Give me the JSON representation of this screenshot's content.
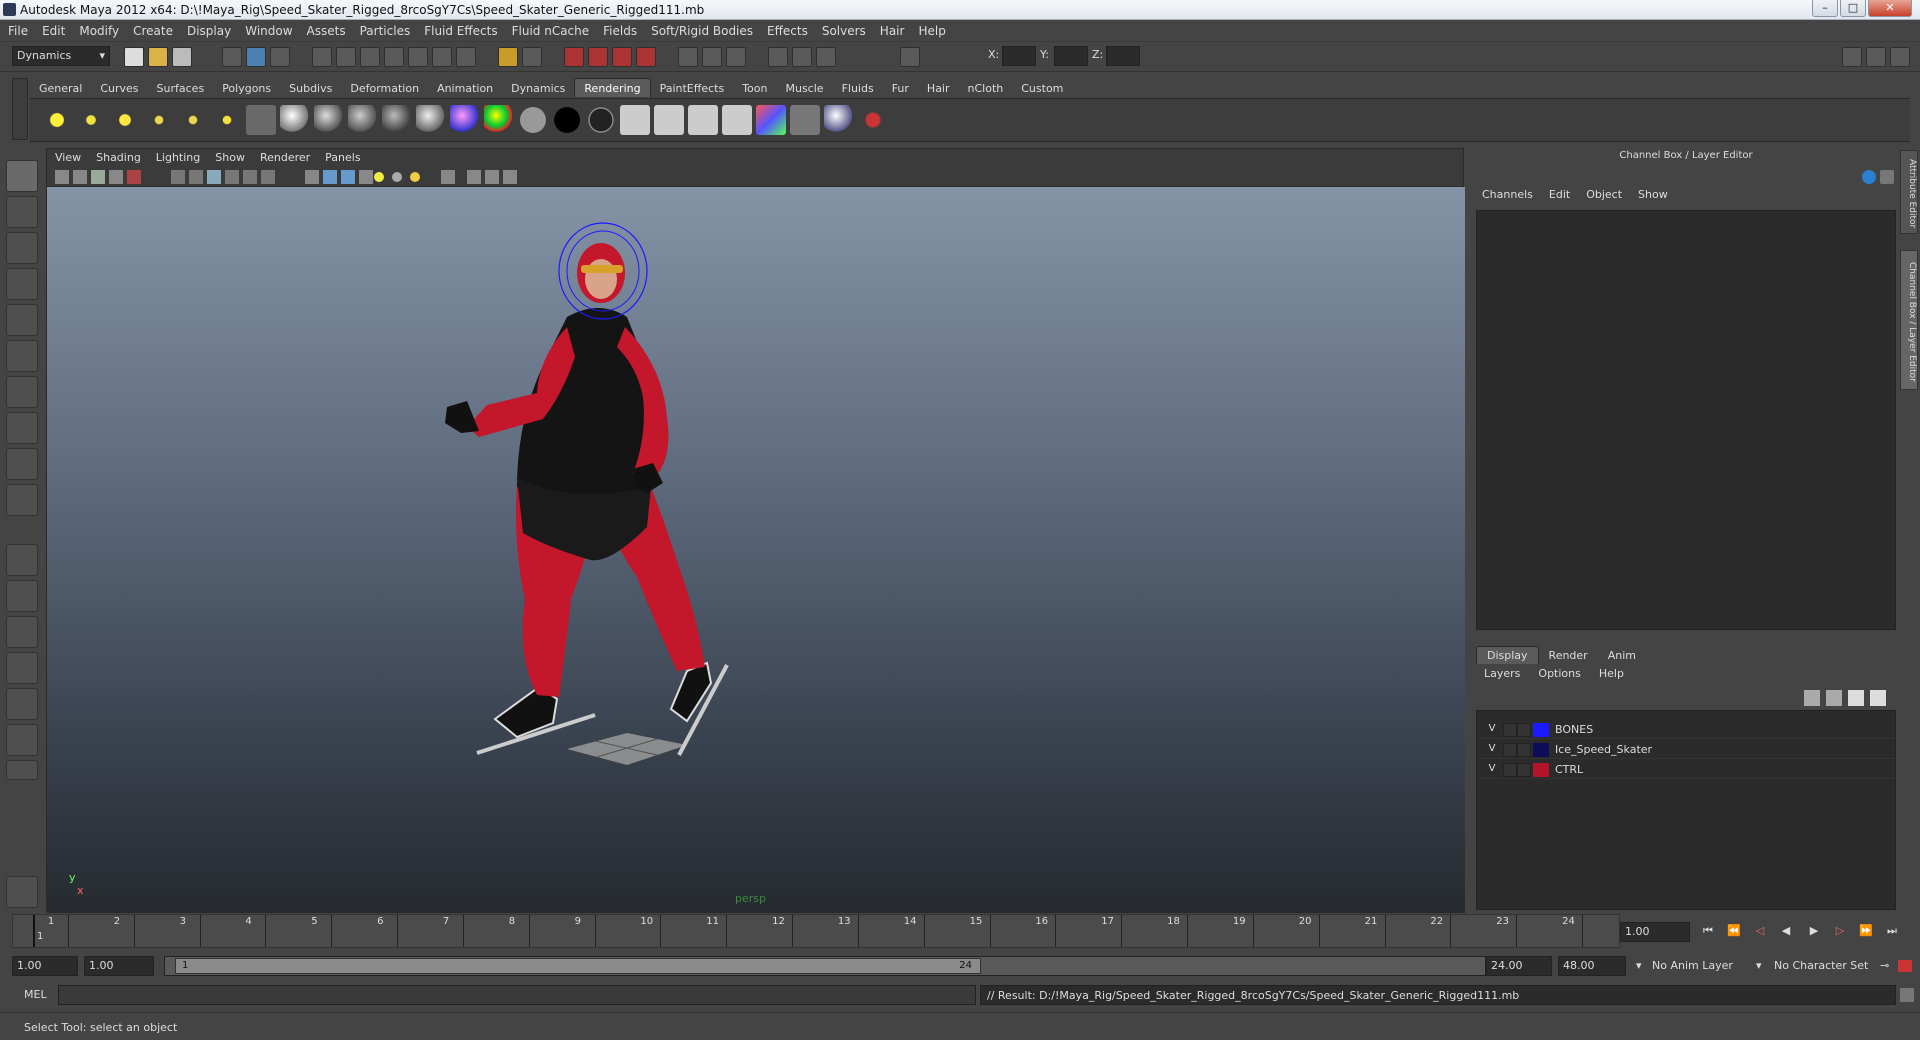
{
  "window": {
    "title": "Autodesk Maya 2012 x64: D:\\!Maya_Rig\\Speed_Skater_Rigged_8rcoSgY7Cs\\Speed_Skater_Generic_Rigged111.mb",
    "min": "–",
    "max": "□",
    "close": "✕"
  },
  "menubar": [
    "File",
    "Edit",
    "Modify",
    "Create",
    "Display",
    "Window",
    "Assets",
    "Particles",
    "Fluid Effects",
    "Fluid nCache",
    "Fields",
    "Soft/Rigid Bodies",
    "Effects",
    "Solvers",
    "Hair",
    "Help"
  ],
  "statusline": {
    "menuset": "Dynamics",
    "x_label": "X:",
    "y_label": "Y:",
    "z_label": "Z:"
  },
  "shelf": {
    "tabs": [
      "General",
      "Curves",
      "Surfaces",
      "Polygons",
      "Subdivs",
      "Deformation",
      "Animation",
      "Dynamics",
      "Rendering",
      "PaintEffects",
      "Toon",
      "Muscle",
      "Fluids",
      "Fur",
      "Hair",
      "nCloth",
      "Custom"
    ],
    "active_tab": "Rendering"
  },
  "viewport": {
    "menu": [
      "View",
      "Shading",
      "Lighting",
      "Show",
      "Renderer",
      "Panels"
    ],
    "camera_label": "persp",
    "axis_y": "y",
    "axis_x": "x"
  },
  "channel_box": {
    "title": "Channel Box / Layer Editor",
    "menu": [
      "Channels",
      "Edit",
      "Object",
      "Show"
    ]
  },
  "layer_editor": {
    "tabs": [
      "Display",
      "Render",
      "Anim"
    ],
    "active_tab": "Display",
    "menu": [
      "Layers",
      "Options",
      "Help"
    ],
    "layers": [
      {
        "visible": "V",
        "name": "BONES",
        "color": "#1a1aff"
      },
      {
        "visible": "V",
        "name": "Ice_Speed_Skater",
        "color": "#0d0d5a"
      },
      {
        "visible": "V",
        "name": "CTRL",
        "color": "#b3142a"
      }
    ]
  },
  "side_tabs": [
    "Attribute Editor",
    "Channel Box / Layer Editor"
  ],
  "timeline": {
    "ticks": [
      "1",
      "2",
      "3",
      "4",
      "5",
      "6",
      "7",
      "8",
      "9",
      "10",
      "11",
      "12",
      "13",
      "14",
      "15",
      "16",
      "17",
      "18",
      "19",
      "20",
      "21",
      "22",
      "23",
      "24"
    ],
    "current_frame_marker": "1",
    "current_frame": "1.00"
  },
  "range": {
    "start_anim": "1.00",
    "start_play": "1.00",
    "range_start": "1",
    "range_end": "24",
    "end_play": "24.00",
    "end_anim": "48.00",
    "anim_layer": "No Anim Layer",
    "char_set": "No Character Set"
  },
  "command": {
    "mel": "MEL",
    "result": "// Result: D:/!Maya_Rig/Speed_Skater_Rigged_8rcoSgY7Cs/Speed_Skater_Generic_Rigged111.mb"
  },
  "help_line": "Select Tool: select an object",
  "colors": {
    "suit_red": "#c4172b",
    "suit_black": "#141414",
    "bones_blue": "#1a1aff"
  }
}
